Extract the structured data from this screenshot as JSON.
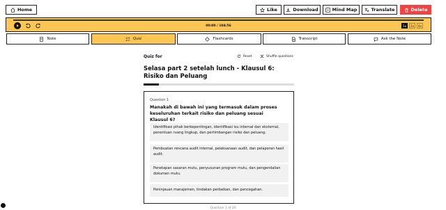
{
  "header": {
    "home_label": "Home",
    "like_label": "Like",
    "download_label": "Download",
    "mindmap_label": "Mind Map",
    "translate_label": "Translate",
    "delete_label": "Delete"
  },
  "player": {
    "time": "00:00 / 104:56",
    "speeds": [
      "1x",
      "2x",
      "4x"
    ],
    "selected_speed": "1x",
    "progress": 0
  },
  "tabs": [
    {
      "label": "Note",
      "icon": "note-icon"
    },
    {
      "label": "Quiz",
      "icon": "quiz-icon",
      "active": true
    },
    {
      "label": "Flashcards",
      "icon": "flashcard-icon"
    },
    {
      "label": "Transcript",
      "icon": "transcript-icon"
    },
    {
      "label": "Ask the Note",
      "icon": "chat-icon"
    }
  ],
  "quiz": {
    "for_label": "Quiz for",
    "reset_label": "Reset",
    "shuffle_label": "Shuffle questions",
    "title": "Selasa part 2 setelah lunch - Klausul 6: Risiko dan Peluang",
    "progress_fraction": 0.1,
    "question_number": "Question 1",
    "question_text": "Manakah di bawah ini yang termasuk dalam proses keseluruhan terkait risiko dan peluang sesuai Klausul 6?",
    "options": [
      "Identifikasi pihak berkepentingan, identifikasi isu internal dan eksternal, penentuan ruang lingkup, dan pertimbangan risiko dan peluang.",
      "Pembuatan rencana audit internal, pelaksanaan audit, dan pelaporan hasil audit.",
      "Penetapan sasaran mutu, penyusunan program mutu, dan pengendalian dokumen mutu.",
      "Peninjauan manajemen, tindakan perbaikan, dan pencegahan."
    ],
    "footer": "Question 1 of 20"
  },
  "colors": {
    "accent": "#fcc654",
    "delete": "#ef4444"
  }
}
